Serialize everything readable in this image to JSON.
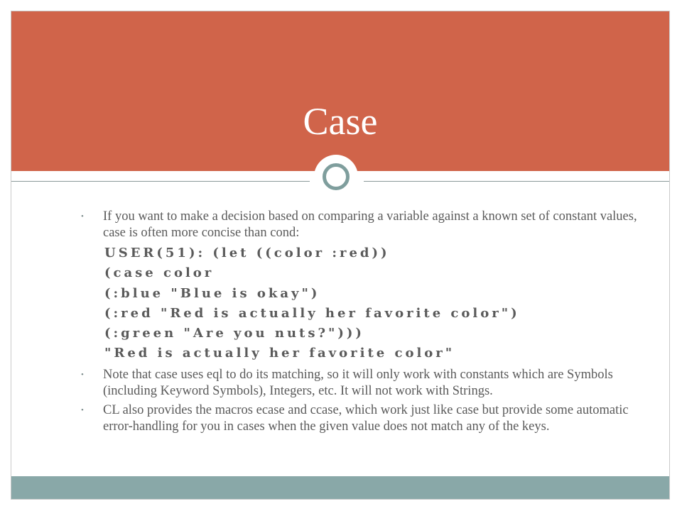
{
  "slide": {
    "title": "Case",
    "bullets": [
      {
        "marker": "•",
        "text": "If you want to make a decision based on comparing a variable against a known set of constant values, case is often more concise than cond:"
      },
      {
        "marker": "•",
        "text": "Note that case uses eql to do its matching, so it will only work with constants which are Symbols (including Keyword Symbols), Integers, etc. It will not work with Strings."
      },
      {
        "marker": "•",
        "text": "CL also provides the macros ecase and ccase, which work just like case but provide some automatic error-handling for you in cases when the given value does not match any of the keys."
      }
    ],
    "code_lines": [
      "USER(51): (let ((color :red))",
      "(case color",
      "(:blue \"Blue is okay\")",
      "(:red \"Red is actually her favorite color\")",
      "(:green \"Are you nuts?\")))",
      "\"Red is actually her favorite color\""
    ]
  },
  "colors": {
    "header": "#d0644a",
    "footer": "#89a8a8",
    "ring": "#7f9e9d",
    "text": "#5a5a5a"
  },
  "icons": {
    "divider_ornament": "circle-ring-icon"
  }
}
